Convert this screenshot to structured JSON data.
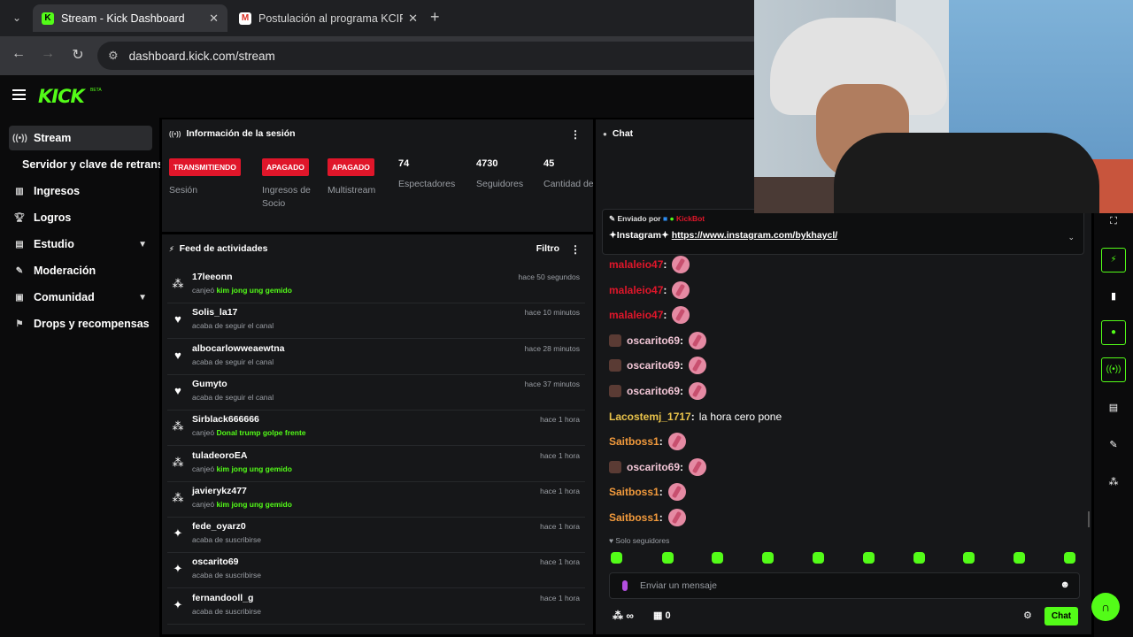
{
  "browser": {
    "tabs": [
      {
        "title": "Stream - Kick Dashboard",
        "favicon": "K"
      },
      {
        "title": "Postulación al programa KCIP –",
        "favicon": "M"
      }
    ],
    "url": "dashboard.kick.com/stream"
  },
  "app": {
    "logo": "KICK",
    "logo_badge": "BETA"
  },
  "sidebar": {
    "items": [
      {
        "label": "Stream",
        "icon": "broadcast-icon"
      },
      {
        "label": "Servidor y clave de retransmisión"
      },
      {
        "label": "Ingresos",
        "icon": "chart-icon"
      },
      {
        "label": "Logros",
        "icon": "trophy-icon"
      },
      {
        "label": "Estudio",
        "icon": "studio-icon"
      },
      {
        "label": "Moderación",
        "icon": "wrench-icon"
      },
      {
        "label": "Comunidad",
        "icon": "community-icon"
      },
      {
        "label": "Drops y recompensas",
        "icon": "drops-icon"
      }
    ]
  },
  "session": {
    "title": "Información de la sesión",
    "stats": [
      {
        "badge": "TRANSMITIENDO",
        "label": "Sesión"
      },
      {
        "badge": "APAGADO",
        "label": "Ingresos de Socio"
      },
      {
        "badge": "APAGADO",
        "label": "Multistream"
      },
      {
        "value": "74",
        "label": "Espectadores"
      },
      {
        "value": "4730",
        "label": "Seguidores"
      },
      {
        "value": "45",
        "label": "Cantidad de suscripciones"
      }
    ]
  },
  "feed": {
    "title": "Feed de actividades",
    "filter_label": "Filtro",
    "items": [
      {
        "user": "17leeonn",
        "prefix": "canjeó",
        "highlight": "kim jong ung gemido",
        "sub": "",
        "time": "hace 50 segundos",
        "icon": "redeem"
      },
      {
        "user": "Solis_la17",
        "prefix": "",
        "highlight": "",
        "sub": "acaba de seguir el canal",
        "time": "hace 10 minutos",
        "icon": "heart"
      },
      {
        "user": "albocarlowweaewtna",
        "prefix": "",
        "highlight": "",
        "sub": "acaba de seguir el canal",
        "time": "hace 28 minutos",
        "icon": "heart"
      },
      {
        "user": "Gumyto",
        "prefix": "",
        "highlight": "",
        "sub": "acaba de seguir el canal",
        "time": "hace 37 minutos",
        "icon": "heart"
      },
      {
        "user": "Sirblack666666",
        "prefix": "canjeó",
        "highlight": "Donal trump golpe frente",
        "sub": "",
        "time": "hace 1 hora",
        "icon": "redeem"
      },
      {
        "user": "tuladeoroEA",
        "prefix": "canjeó",
        "highlight": "kim jong ung gemido",
        "sub": "",
        "time": "hace 1 hora",
        "icon": "redeem"
      },
      {
        "user": "javierykz477",
        "prefix": "canjeó",
        "highlight": "kim jong ung gemido",
        "sub": "",
        "time": "hace 1 hora",
        "icon": "redeem"
      },
      {
        "user": "fede_oyarz0",
        "prefix": "",
        "highlight": "",
        "sub": "acaba de suscribirse",
        "time": "hace 1 hora",
        "icon": "sparkle"
      },
      {
        "user": "oscarito69",
        "prefix": "",
        "highlight": "",
        "sub": "acaba de suscribirse",
        "time": "hace 1 hora",
        "icon": "sparkle"
      },
      {
        "user": "fernandooll_g",
        "prefix": "",
        "highlight": "",
        "sub": "acaba de suscribirse",
        "time": "hace 1 hora",
        "icon": "sparkle"
      }
    ]
  },
  "chat": {
    "title": "Chat",
    "pinned": {
      "sent_by": "Enviado por",
      "sender": "KickBot",
      "message_prefix": "✦Instagram✦",
      "link": "https://www.instagram.com/bykhaycl/"
    },
    "messages": [
      {
        "user": "malaleio47",
        "color": "#e0162a",
        "avatar": false,
        "emote": true,
        "text": ""
      },
      {
        "user": "malaleio47",
        "color": "#e0162a",
        "avatar": false,
        "emote": true,
        "text": ""
      },
      {
        "user": "malaleio47",
        "color": "#e0162a",
        "avatar": false,
        "emote": true,
        "text": ""
      },
      {
        "user": "oscarito69",
        "color": "#f2c6d6",
        "avatar": true,
        "emote": true,
        "text": ""
      },
      {
        "user": "oscarito69",
        "color": "#f2c6d6",
        "avatar": true,
        "emote": true,
        "text": ""
      },
      {
        "user": "oscarito69",
        "color": "#f2c6d6",
        "avatar": true,
        "emote": true,
        "text": ""
      },
      {
        "user": "Lacostemj_1717",
        "color": "#e8c24a",
        "avatar": false,
        "emote": false,
        "text": "la hora cero pone"
      },
      {
        "user": "Saitboss1",
        "color": "#f29a3c",
        "avatar": false,
        "emote": true,
        "text": ""
      },
      {
        "user": "oscarito69",
        "color": "#f2c6d6",
        "avatar": true,
        "emote": true,
        "text": ""
      },
      {
        "user": "Saitboss1",
        "color": "#f29a3c",
        "avatar": false,
        "emote": true,
        "text": ""
      },
      {
        "user": "Saitboss1",
        "color": "#f29a3c",
        "avatar": false,
        "emote": true,
        "text": ""
      }
    ],
    "mode_label": "Solo seguidores",
    "input_placeholder": "Enviar un mensaje",
    "viewers_infinity": "∞",
    "gift_count": "0",
    "send_label": "Chat"
  },
  "colors": {
    "accent": "#53fc18",
    "badge_red": "#e0162a",
    "panel_bg": "#161719"
  }
}
